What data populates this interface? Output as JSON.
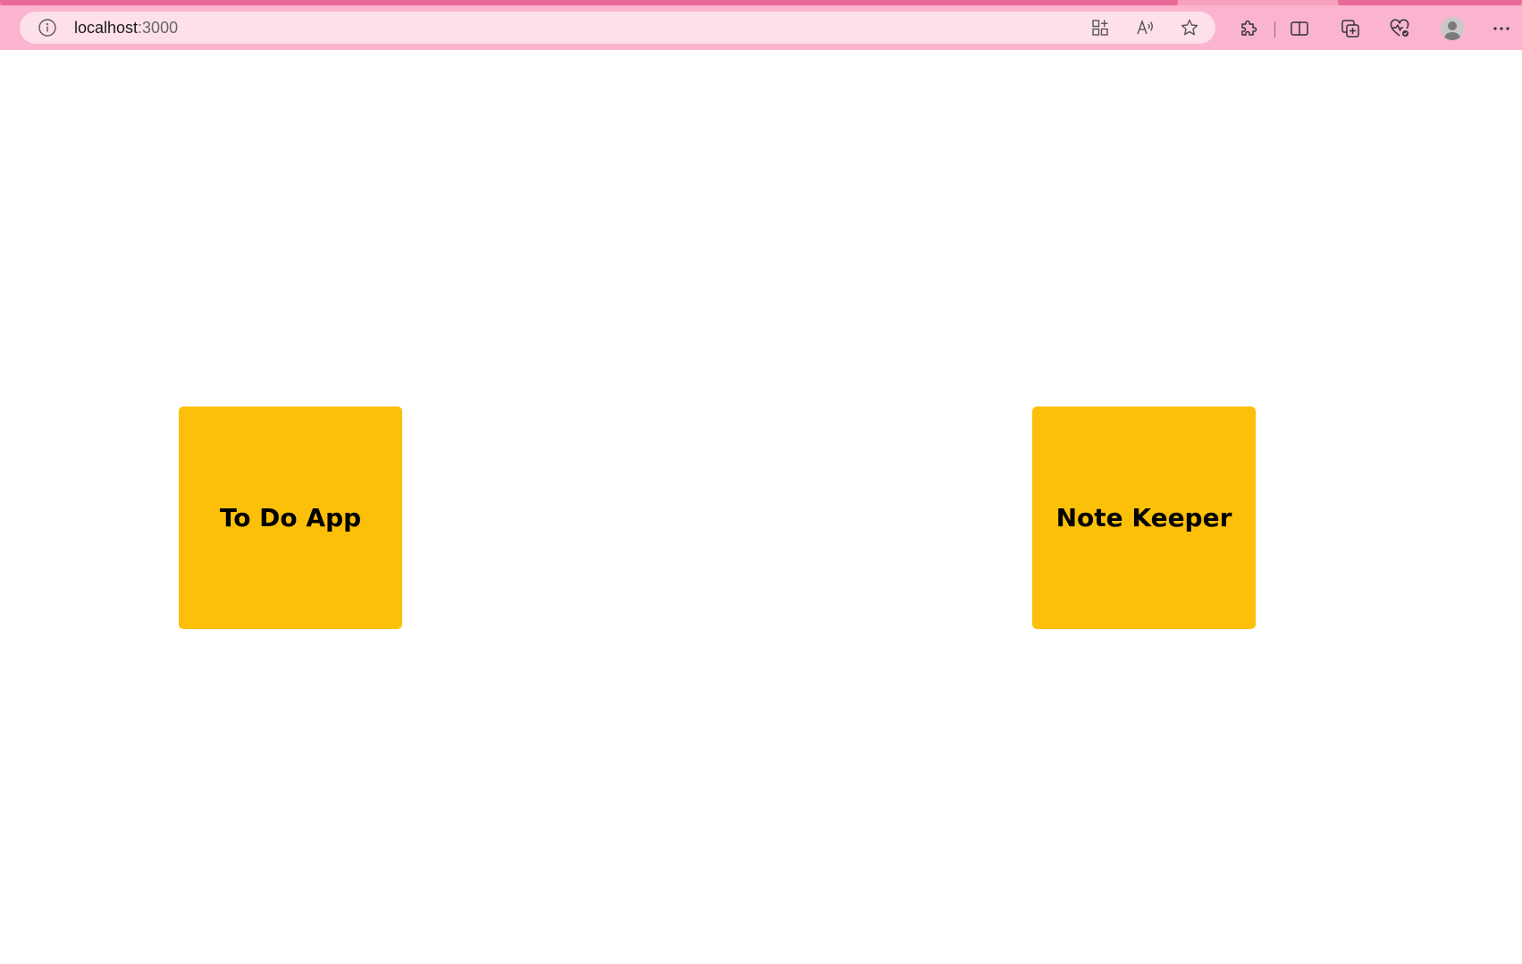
{
  "browser": {
    "address_bar": {
      "host": "localhost",
      "port": ":3000"
    },
    "icons": {
      "site_info": "info-icon",
      "apps": "apps-icon",
      "read_aloud": "read-aloud-icon",
      "favorite": "star-icon",
      "extensions": "puzzle-icon",
      "split_screen": "split-screen-icon",
      "collections": "collections-icon",
      "performance": "heart-pulse-icon",
      "profile": "avatar-icon",
      "menu": "more-icon"
    },
    "colors": {
      "toolbar": "#fbb4cf",
      "address_bar": "#fde0ea",
      "tab_strip": "#e96a97"
    }
  },
  "page": {
    "cards": [
      {
        "label": "To Do App"
      },
      {
        "label": "Note Keeper"
      }
    ],
    "colors": {
      "card": "#fdc009",
      "card_text": "#000000",
      "background": "#ffffff"
    }
  }
}
